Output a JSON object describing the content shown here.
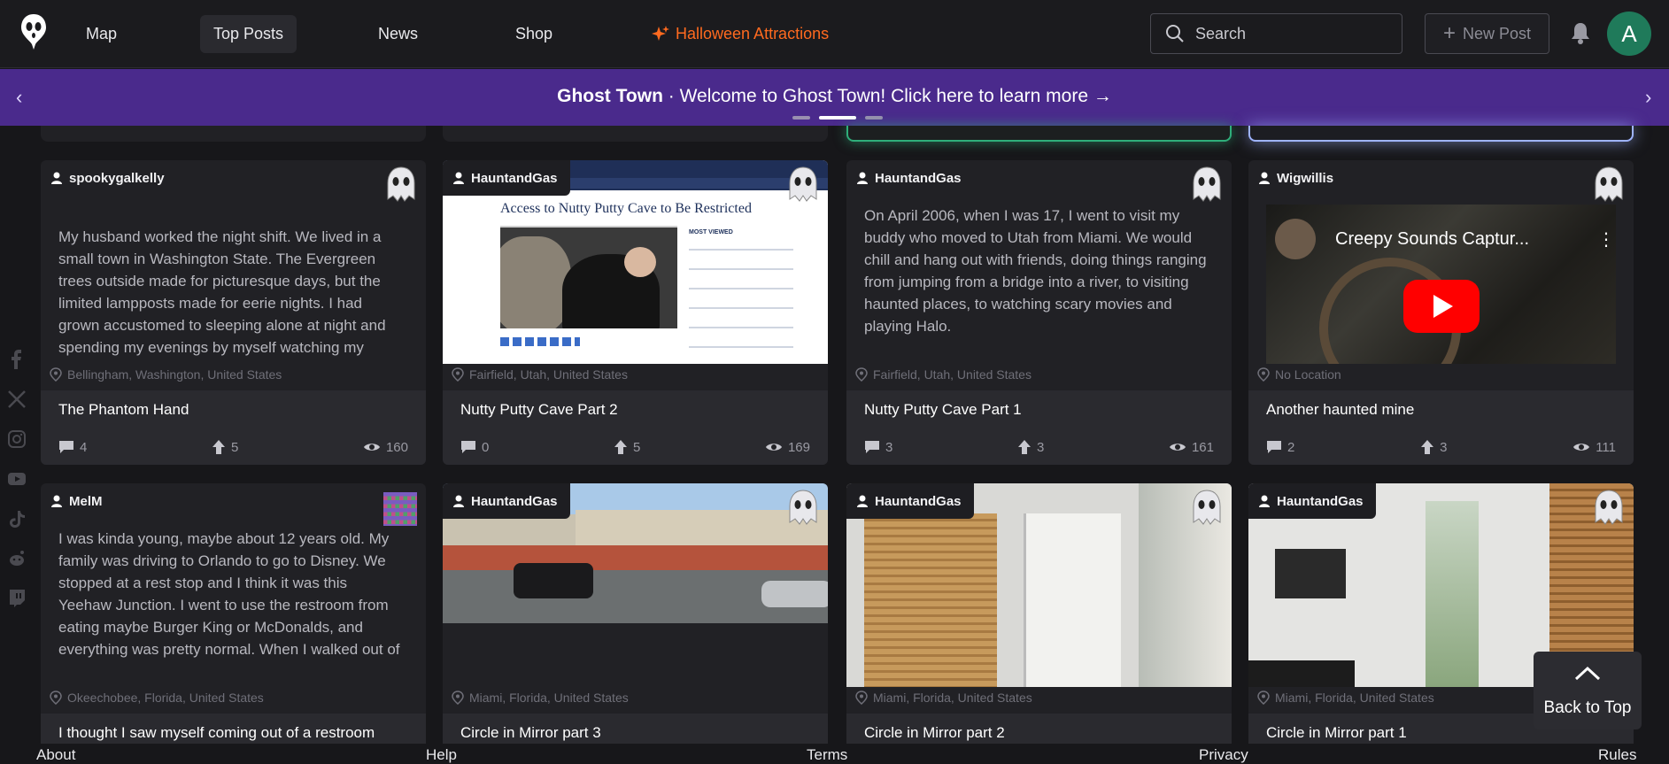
{
  "nav": {
    "links": [
      "Map",
      "Top Posts",
      "News",
      "Shop"
    ],
    "halloween": "Halloween Attractions",
    "search_placeholder": "Search",
    "new_post": "New Post",
    "avatar_letter": "A"
  },
  "banner": {
    "brand": "Ghost Town",
    "separator": "·",
    "message": "Welcome to Ghost Town! Click here to learn more",
    "arrow": "→"
  },
  "posts": [
    {
      "user": "spookygalkelly",
      "excerpt": "My husband worked the night shift. We lived in a small town in Washington State. The Evergreen trees outside made for picturesque days, but the limited lampposts made for eerie nights. I had grown accustomed to sleeping alone at night and spending my evenings by myself watching my",
      "location": "Bellingham, Washington, United States",
      "title": "The Phantom Hand",
      "comments": "4",
      "upvotes": "5",
      "views": "160"
    },
    {
      "user": "HauntandGas",
      "media_headline": "Access to Nutty Putty Cave to Be Restricted",
      "media_sidebar": "MOST VIEWED",
      "location": "Fairfield, Utah, United States",
      "title": "Nutty Putty Cave Part 2",
      "comments": "0",
      "upvotes": "5",
      "views": "169"
    },
    {
      "user": "HauntandGas",
      "excerpt": "On April 2006, when I was 17, I went to visit my buddy who moved to Utah from Miami. We would chill and hang out with friends, doing things ranging from jumping from a bridge into a river, to visiting haunted places, to watching scary movies and playing Halo.",
      "location": "Fairfield, Utah, United States",
      "title": "Nutty Putty Cave Part 1",
      "comments": "3",
      "upvotes": "3",
      "views": "161"
    },
    {
      "user": "Wigwillis",
      "video_title": "Creepy Sounds Captur...",
      "location": "No Location",
      "title": "Another haunted mine",
      "comments": "2",
      "upvotes": "3",
      "views": "111"
    },
    {
      "user": "MelM",
      "excerpt": "I was kinda young, maybe about 12 years old. My family was driving to Orlando to go to Disney. We stopped at a rest stop and I think it was this Yeehaw Junction. I went to use the restroom from eating maybe Burger King or McDonalds, and everything was pretty normal. When I walked out of the bathroom, the stalls were lined up side to",
      "location": "Okeechobee, Florida, United States",
      "title": "I thought I saw myself coming out of a restroom"
    },
    {
      "user": "HauntandGas",
      "location": "Miami, Florida, United States",
      "title": "Circle in Mirror part 3"
    },
    {
      "user": "HauntandGas",
      "location": "Miami, Florida, United States",
      "title": "Circle in Mirror part 2"
    },
    {
      "user": "HauntandGas",
      "location": "Miami, Florida, United States",
      "title": "Circle in Mirror part 1"
    }
  ],
  "back_to_top": "Back to Top",
  "footer": [
    "About",
    "Help",
    "Terms",
    "Privacy",
    "Rules"
  ],
  "colors": {
    "banner": "#4a2a8c",
    "accent_orange": "#ff6a1f",
    "avatar": "#1f7a5a",
    "card": "#212125",
    "glow_green": "#2fae7a",
    "glow_blue": "#9fb4ff",
    "youtube_red": "#ff0000"
  },
  "social_icons": [
    "facebook-icon",
    "x-icon",
    "instagram-icon",
    "youtube-icon",
    "tiktok-icon",
    "reddit-icon",
    "twitch-icon"
  ]
}
